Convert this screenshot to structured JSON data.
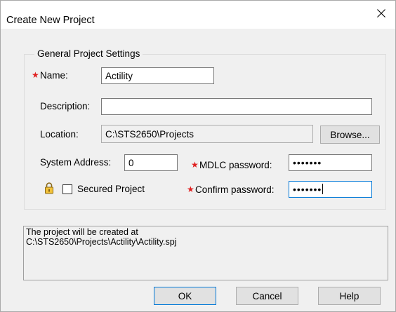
{
  "window": {
    "title": "Create New Project",
    "close_icon": "close-icon"
  },
  "group": {
    "legend": "General Project Settings"
  },
  "fields": {
    "name_label": "Name:",
    "name_value": "Actility",
    "description_label": "Description:",
    "description_value": "",
    "location_label": "Location:",
    "location_value": "C:\\STS2650\\Projects",
    "browse_label": "Browse...",
    "system_address_label": "System Address:",
    "system_address_value": "0",
    "mdlc_password_label": "MDLC password:",
    "mdlc_password_value": "•••••••",
    "secured_label": "Secured Project",
    "secured_checked": false,
    "confirm_password_label": "Confirm password:",
    "confirm_password_value": "•••••••"
  },
  "info": {
    "line1": "The project will be created at",
    "line2": "C:\\STS2650\\Projects\\Actility\\Actility.spj"
  },
  "buttons": {
    "ok": "OK",
    "cancel": "Cancel",
    "help": "Help"
  },
  "colors": {
    "required_star": "#e02020",
    "focus_border": "#0078d7",
    "dialog_bg": "#f0f0f0"
  }
}
